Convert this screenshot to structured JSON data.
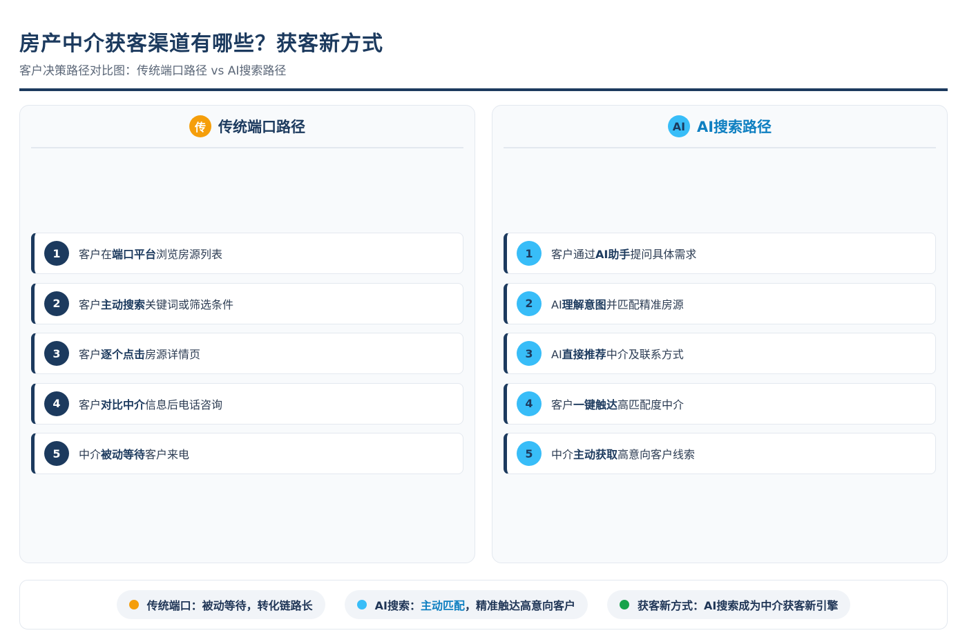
{
  "header": {
    "title": "房产中介获客渠道有哪些？获客新方式",
    "subtitle": "客户决策路径对比图：传统端口路径 vs AI搜索路径"
  },
  "left_panel": {
    "badge": "传",
    "title": "传统端口路径",
    "accent_color": "#f59e0b",
    "steps": [
      {
        "num": "1",
        "pre": "客户在",
        "bold": "端口平台",
        "post": "浏览房源列表"
      },
      {
        "num": "2",
        "pre": "客户",
        "bold": "主动搜索",
        "post": "关键词或筛选条件"
      },
      {
        "num": "3",
        "pre": "客户",
        "bold": "逐个点击",
        "post": "房源详情页"
      },
      {
        "num": "4",
        "pre": "客户",
        "bold": "对比中介",
        "post": "信息后电话咨询"
      },
      {
        "num": "5",
        "pre": "中介",
        "bold": "被动等待",
        "post": "客户来电"
      }
    ]
  },
  "right_panel": {
    "badge": "AI",
    "title": "AI搜索路径",
    "accent_color": "#38bdf8",
    "steps": [
      {
        "num": "1",
        "pre": "客户通过",
        "bold": "AI助手",
        "post": "提问具体需求"
      },
      {
        "num": "2",
        "pre": "AI",
        "bold": "理解意图",
        "post": "并匹配精准房源"
      },
      {
        "num": "3",
        "pre": "AI",
        "bold": "直接推荐",
        "post": "中介及联系方式"
      },
      {
        "num": "4",
        "pre": "客户",
        "bold": "一键触达",
        "post": "高匹配度中介"
      },
      {
        "num": "5",
        "pre": "中介",
        "bold": "主动获取",
        "post": "高意向客户线索"
      }
    ]
  },
  "summary": {
    "items": [
      {
        "text_a": "传统端口：被动等待，转化链路长",
        "highlight": "",
        "text_b": ""
      },
      {
        "text_a": "AI搜索：",
        "highlight": "主动匹配",
        "text_b": "，精准触达高意向客户"
      },
      {
        "text_a": "获客新方式：AI搜索成为中介获客新引擎",
        "highlight": "",
        "text_b": ""
      }
    ]
  },
  "colors": {
    "navy": "#1c3a5e",
    "orange": "#f59e0b",
    "sky": "#38bdf8",
    "green": "#16a34a"
  }
}
